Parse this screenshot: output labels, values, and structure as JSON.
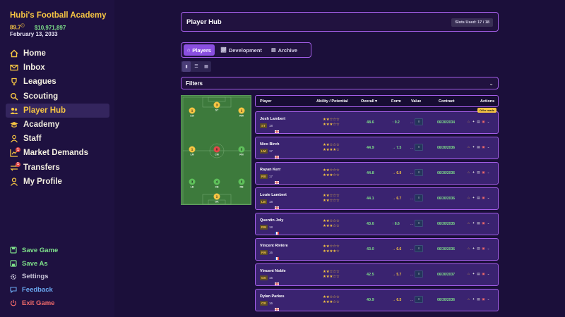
{
  "app": {
    "title": "Hubi's Football Academy",
    "reputation": "89.7",
    "reputation_icon": "circle-info",
    "money": "$10,971,897",
    "date": "February 13, 2033"
  },
  "sidebar": {
    "items": [
      {
        "label": "Home",
        "icon": "home"
      },
      {
        "label": "Inbox",
        "icon": "mail"
      },
      {
        "label": "Leagues",
        "icon": "trophy"
      },
      {
        "label": "Scouting",
        "icon": "search"
      },
      {
        "label": "Player Hub",
        "icon": "people",
        "active": true
      },
      {
        "label": "Academy",
        "icon": "graduation-cap"
      },
      {
        "label": "Staff",
        "icon": "staff"
      },
      {
        "label": "Market Demands",
        "icon": "chart",
        "badge": "1"
      },
      {
        "label": "Transfers",
        "icon": "transfer",
        "badge": "1"
      },
      {
        "label": "My Profile",
        "icon": "user"
      }
    ],
    "bottom": [
      {
        "label": "Save Game",
        "color": "#7ee08a",
        "icon": "save"
      },
      {
        "label": "Save As",
        "color": "#7ee08a",
        "icon": "save-as"
      },
      {
        "label": "Settings",
        "color": "#c8c4d8",
        "icon": "gear"
      },
      {
        "label": "Feedback",
        "color": "#6aa8f0",
        "icon": "chat"
      },
      {
        "label": "Exit Game",
        "color": "#f06a6a",
        "icon": "power"
      }
    ]
  },
  "header": {
    "title": "Player Hub",
    "slots": "Slots Used: 17 / 18"
  },
  "tabs": [
    {
      "label": "Players",
      "active": true
    },
    {
      "label": "Development"
    },
    {
      "label": "Archive"
    }
  ],
  "filters": {
    "label": "Filters"
  },
  "pitch": {
    "positions": [
      {
        "label": "ST",
        "number": "3",
        "color": "#f6c543"
      },
      {
        "label": "LW",
        "number": "1",
        "color": "#f6c543"
      },
      {
        "label": "RW",
        "number": "1",
        "color": "#f6c543"
      },
      {
        "label": "LM",
        "number": "1",
        "color": "#f6c543"
      },
      {
        "label": "CM",
        "number": "0",
        "color": "#e04848"
      },
      {
        "label": "RM",
        "number": "3",
        "color": "#5ec05a"
      },
      {
        "label": "LB",
        "number": "3",
        "color": "#5ec05a"
      },
      {
        "label": "CB",
        "number": "4",
        "color": "#5ec05a"
      },
      {
        "label": "RB",
        "number": "3",
        "color": "#5ec05a"
      },
      {
        "label": "GK",
        "number": "1",
        "color": "#f6c543"
      }
    ]
  },
  "table": {
    "headers": {
      "player": "Player",
      "ability": "Ability / Potential",
      "overall": "Overall ▾",
      "form": "Form",
      "value": "Value",
      "contract": "Contract",
      "actions": "Actions"
    },
    "offer_label": "Offer made",
    "rows": [
      {
        "name": "Josh Lambert",
        "pos": "ST",
        "age": "18",
        "flag": "en",
        "ability": "★★☆☆☆",
        "potential": "★★★☆☆",
        "overall": "48.6",
        "form": "↑ 9.2",
        "form_color": "#7ee08a",
        "value": "...",
        "contract": "06/30/2034",
        "offer": true
      },
      {
        "name": "Nico Birch",
        "pos": "LM",
        "age": "17",
        "flag": "en",
        "ability": "★★☆☆☆",
        "potential": "★★★★☆",
        "overall": "44.9",
        "form": "→ 7.5",
        "form_color": "#7ee08a",
        "value": "...",
        "contract": "06/30/2036"
      },
      {
        "name": "Rayan Kerr",
        "pos": "RB",
        "age": "17",
        "flag": "en",
        "ability": "★★☆☆☆",
        "potential": "★★★☆☆",
        "overall": "44.8",
        "form": "→ 6.9",
        "form_color": "#f6c543",
        "value": "...",
        "contract": "06/30/2036"
      },
      {
        "name": "Louie Lambert",
        "pos": "LB",
        "age": "18",
        "flag": "en",
        "ability": "★★☆☆☆",
        "potential": "★★☆☆☆",
        "overall": "44.1",
        "form": "→ 6.7",
        "form_color": "#f6c543",
        "value": "...",
        "contract": "06/30/2036"
      },
      {
        "name": "Quentin Joly",
        "pos": "RM",
        "age": "18",
        "flag": "fr",
        "ability": "★★☆☆☆",
        "potential": "★★★☆☆",
        "overall": "43.6",
        "form": "↑ 8.6",
        "form_color": "#7ee08a",
        "value": "...",
        "contract": "06/30/2035"
      },
      {
        "name": "Vincent Rivière",
        "pos": "RM",
        "age": "16",
        "flag": "fr",
        "ability": "★★☆☆☆",
        "potential": "★★★★☆",
        "overall": "43.0",
        "form": "→ 6.6",
        "form_color": "#f6c543",
        "value": "...",
        "contract": "06/30/2036"
      },
      {
        "name": "Vincent Noble",
        "pos": "GK",
        "age": "16",
        "flag": "en",
        "ability": "★★☆☆☆",
        "potential": "★★★☆☆",
        "overall": "42.5",
        "form": "→ 5.7",
        "form_color": "#f6c543",
        "value": "...",
        "contract": "06/30/2037"
      },
      {
        "name": "Dylan Parkes",
        "pos": "CB",
        "age": "16",
        "flag": "en",
        "ability": "★★☆☆☆",
        "potential": "★★★☆☆",
        "overall": "40.9",
        "form": "→ 6.5",
        "form_color": "#f6c543",
        "value": "...",
        "contract": "06/30/2036"
      }
    ]
  }
}
